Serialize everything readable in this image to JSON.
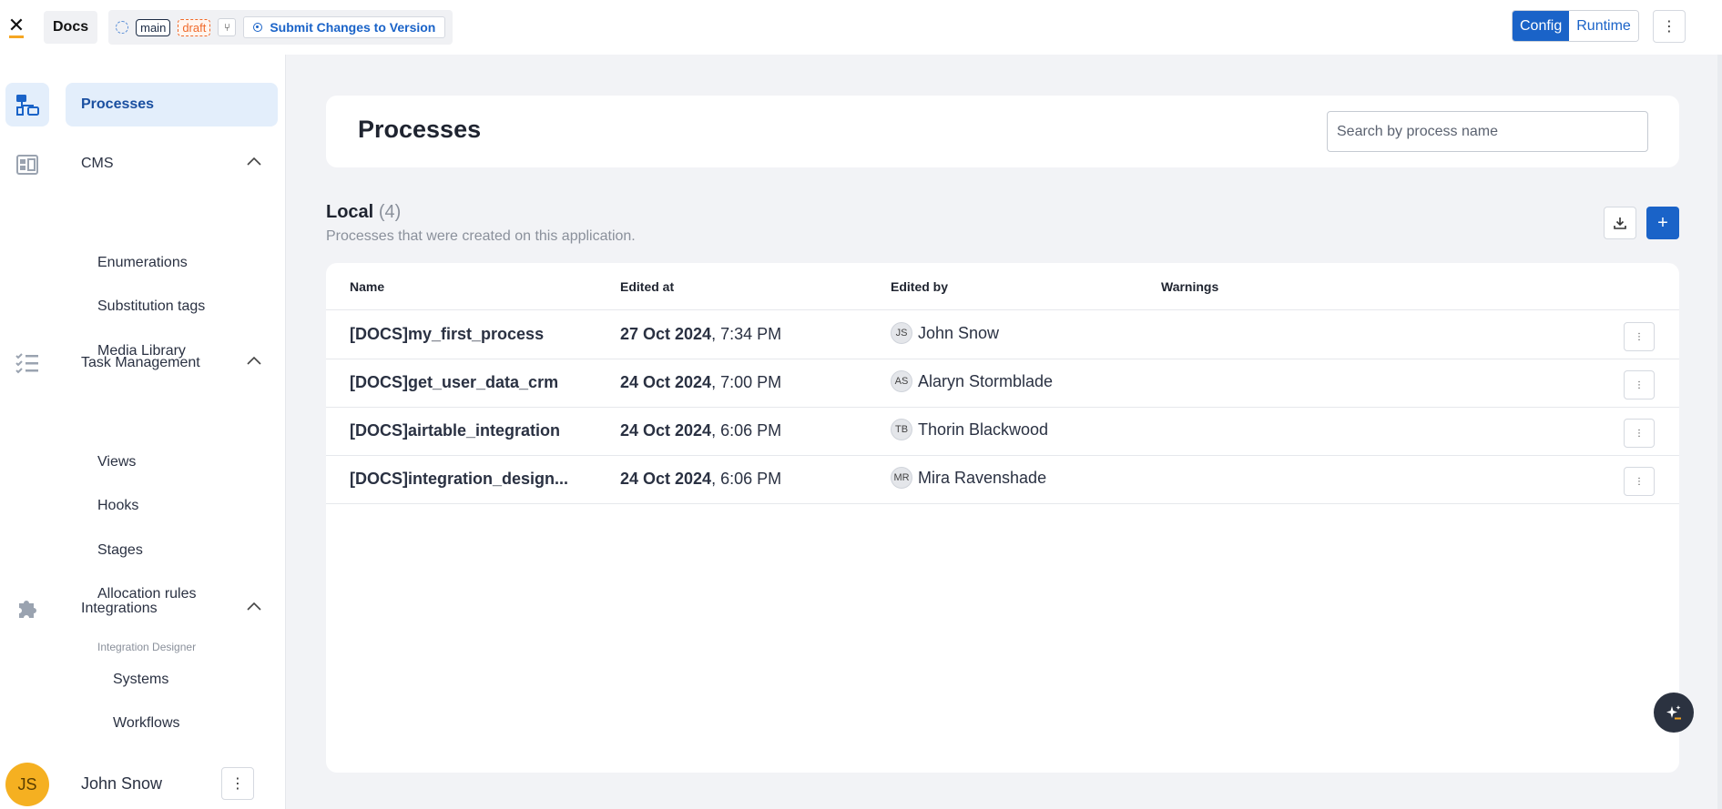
{
  "topbar": {
    "project": "Docs",
    "branch": "main",
    "status": "draft",
    "submit_label": "Submit Changes to Version",
    "mode_config": "Config",
    "mode_runtime": "Runtime",
    "more": "⋮"
  },
  "sidebar": {
    "processes": "Processes",
    "cms": "CMS",
    "enumerations": "Enumerations",
    "substitution_tags": "Substitution tags",
    "media_library": "Media Library",
    "task_management": "Task Management",
    "views": "Views",
    "hooks": "Hooks",
    "stages": "Stages",
    "allocation_rules": "Allocation rules",
    "integrations": "Integrations",
    "integration_designer": "Integration Designer",
    "systems": "Systems",
    "workflows": "Workflows",
    "user_initials": "JS",
    "user_name": "John Snow",
    "more": "⋮"
  },
  "main": {
    "title": "Processes",
    "search_placeholder": "Search by process name",
    "section_title": "Local",
    "section_count": "(4)",
    "section_desc": "Processes that were created on this application.",
    "add": "+"
  },
  "table": {
    "columns": [
      "Name",
      "Edited at",
      "Edited by",
      "Warnings"
    ],
    "rows": [
      {
        "name": "[DOCS]my_first_process",
        "date": "27 Oct 2024",
        "time": ", 7:34 PM",
        "initials": "JS",
        "user": "John Snow"
      },
      {
        "name": "[DOCS]get_user_data_crm",
        "date": "24 Oct 2024",
        "time": ", 7:00 PM",
        "initials": "AS",
        "user": "Alaryn Stormblade"
      },
      {
        "name": "[DOCS]airtable_integration",
        "date": "24 Oct 2024",
        "time": ", 6:06 PM",
        "initials": "TB",
        "user": "Thorin Blackwood"
      },
      {
        "name": "[DOCS]integration_design...",
        "date": "24 Oct 2024",
        "time": ", 6:06 PM",
        "initials": "MR",
        "user": "Mira Ravenshade"
      }
    ],
    "row_more": "⋮"
  },
  "colors": {
    "accent": "#1a63c8",
    "active_bg": "#e3eefb",
    "draft": "#f06a2a",
    "avatar": "#f5b021"
  },
  "icons": [
    "x-logo-icon",
    "processes-icon",
    "cms-icon",
    "task-list-icon",
    "puzzle-icon",
    "chevron-up-icon",
    "download-icon",
    "sparkle-icon"
  ]
}
